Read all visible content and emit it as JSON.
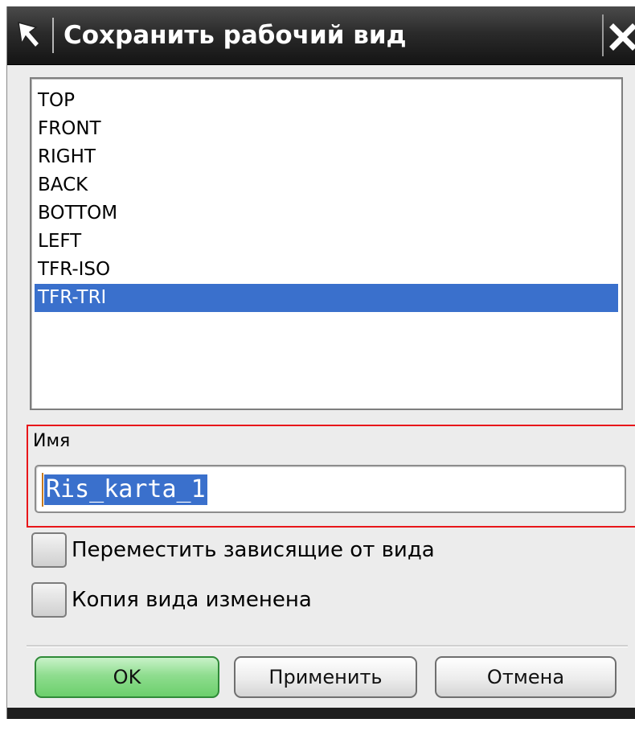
{
  "window": {
    "title": "Сохранить рабочий вид",
    "title_icon": "arrow-cursor-icon",
    "close_icon": "close-icon"
  },
  "views_list": {
    "items": [
      "TOP",
      "FRONT",
      "RIGHT",
      "BACK",
      "BOTTOM",
      "LEFT",
      "TFR-ISO",
      "TFR-TRI"
    ],
    "selected": "TFR-TRI"
  },
  "name_field": {
    "label": "Имя",
    "value": "Ris_karta_1"
  },
  "options": {
    "move_view_dependent_label": "Переместить зависящие от вида",
    "move_view_dependent_checked": false,
    "view_copy_changed_label": "Копия вида изменена",
    "view_copy_changed_checked": false
  },
  "buttons": {
    "ok": "OK",
    "apply": "Применить",
    "cancel": "Отмена"
  },
  "colors": {
    "selection": "#3a70cc",
    "highlight_border": "#e8161a",
    "ok_button": "#8fdd8f",
    "titlebar": "#2b2b2b"
  }
}
